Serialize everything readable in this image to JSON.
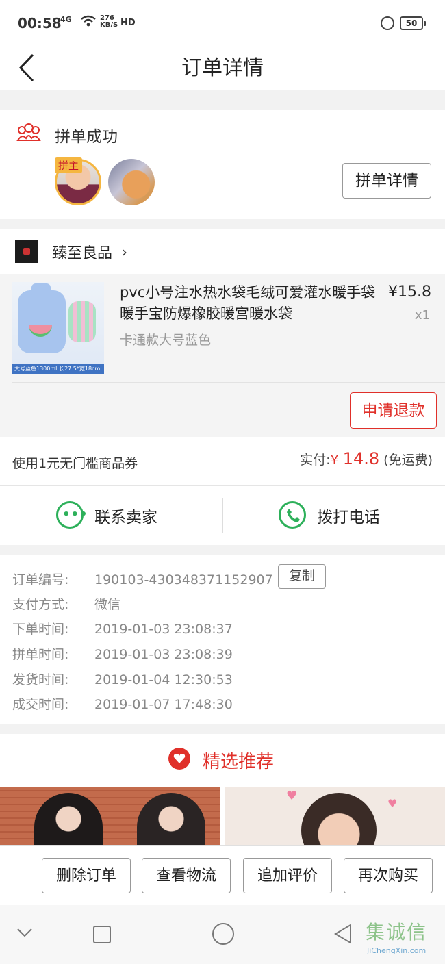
{
  "status_bar": {
    "time": "00:58",
    "network": "4G",
    "speed_top": "276",
    "speed_bottom": "KB/S",
    "hd": "HD",
    "battery": "50"
  },
  "nav": {
    "title": "订单详情"
  },
  "group": {
    "title": "拼单成功",
    "host_badge": "拼主",
    "detail_button": "拼单详情"
  },
  "shop": {
    "name": "臻至良品",
    "product": {
      "title": "pvc小号注水热水袋毛绒可爱灌水暖手袋暖手宝防爆橡胶暖宫暖水袋",
      "variant": "卡通款大号蓝色",
      "price": "¥15.8",
      "quantity": "x1",
      "image_caption": "大号蓝色1300ml:长27.5*宽18cm"
    },
    "refund_button": "申请退款"
  },
  "summary": {
    "coupon": "使用1元无门槛商品券",
    "paid_label": "实付:",
    "currency": "¥",
    "amount": "14.8",
    "shipping_note": "(免运费)"
  },
  "contact": {
    "seller": "联系卖家",
    "phone": "拨打电话"
  },
  "order_info": {
    "copy_button": "复制",
    "rows": [
      {
        "label": "订单编号:",
        "value": "190103-430348371152907"
      },
      {
        "label": "支付方式:",
        "value": "微信"
      },
      {
        "label": "下单时间:",
        "value": "2019-01-03 23:08:37"
      },
      {
        "label": "拼单时间:",
        "value": "2019-01-03 23:08:39"
      },
      {
        "label": "发货时间:",
        "value": "2019-01-04 12:30:53"
      },
      {
        "label": "成交时间:",
        "value": "2019-01-07 17:48:30"
      }
    ]
  },
  "recommend": {
    "title": "精选推荐"
  },
  "actions": [
    "删除订单",
    "查看物流",
    "追加评价",
    "再次购买"
  ],
  "watermark": {
    "text": "集诚信",
    "sub": "JiChengXin.com"
  },
  "colors": {
    "accent_red": "#e0302a",
    "green": "#2db05a",
    "host_gold": "#f5b640"
  }
}
